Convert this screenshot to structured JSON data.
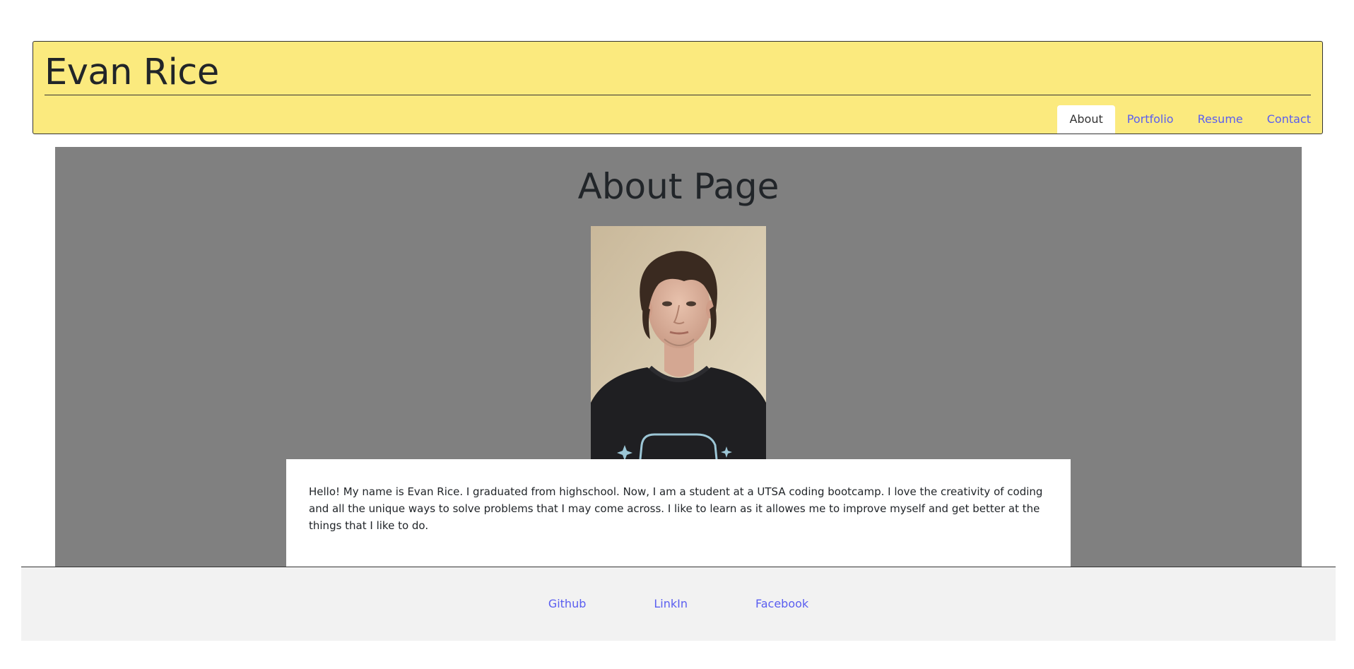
{
  "header": {
    "title": "Evan Rice",
    "bg_color": "#fbea7e",
    "nav": [
      {
        "label": "About",
        "active": true
      },
      {
        "label": "Portfolio",
        "active": false
      },
      {
        "label": "Resume",
        "active": false
      },
      {
        "label": "Contact",
        "active": false
      }
    ]
  },
  "main": {
    "heading": "About Page",
    "bg_color": "#808080",
    "bio": "Hello! My name is Evan Rice. I graduated from highschool. Now, I am a student at a UTSA coding bootcamp. I love the creativity of coding and all the unique ways to solve problems that I may come across. I like to learn as it allowes me to improve myself and get better at the things that I like to do."
  },
  "footer": {
    "links": [
      "Github",
      "LinkIn",
      "Facebook"
    ]
  },
  "colors": {
    "link": "#5a5ef0",
    "text": "#212529"
  }
}
